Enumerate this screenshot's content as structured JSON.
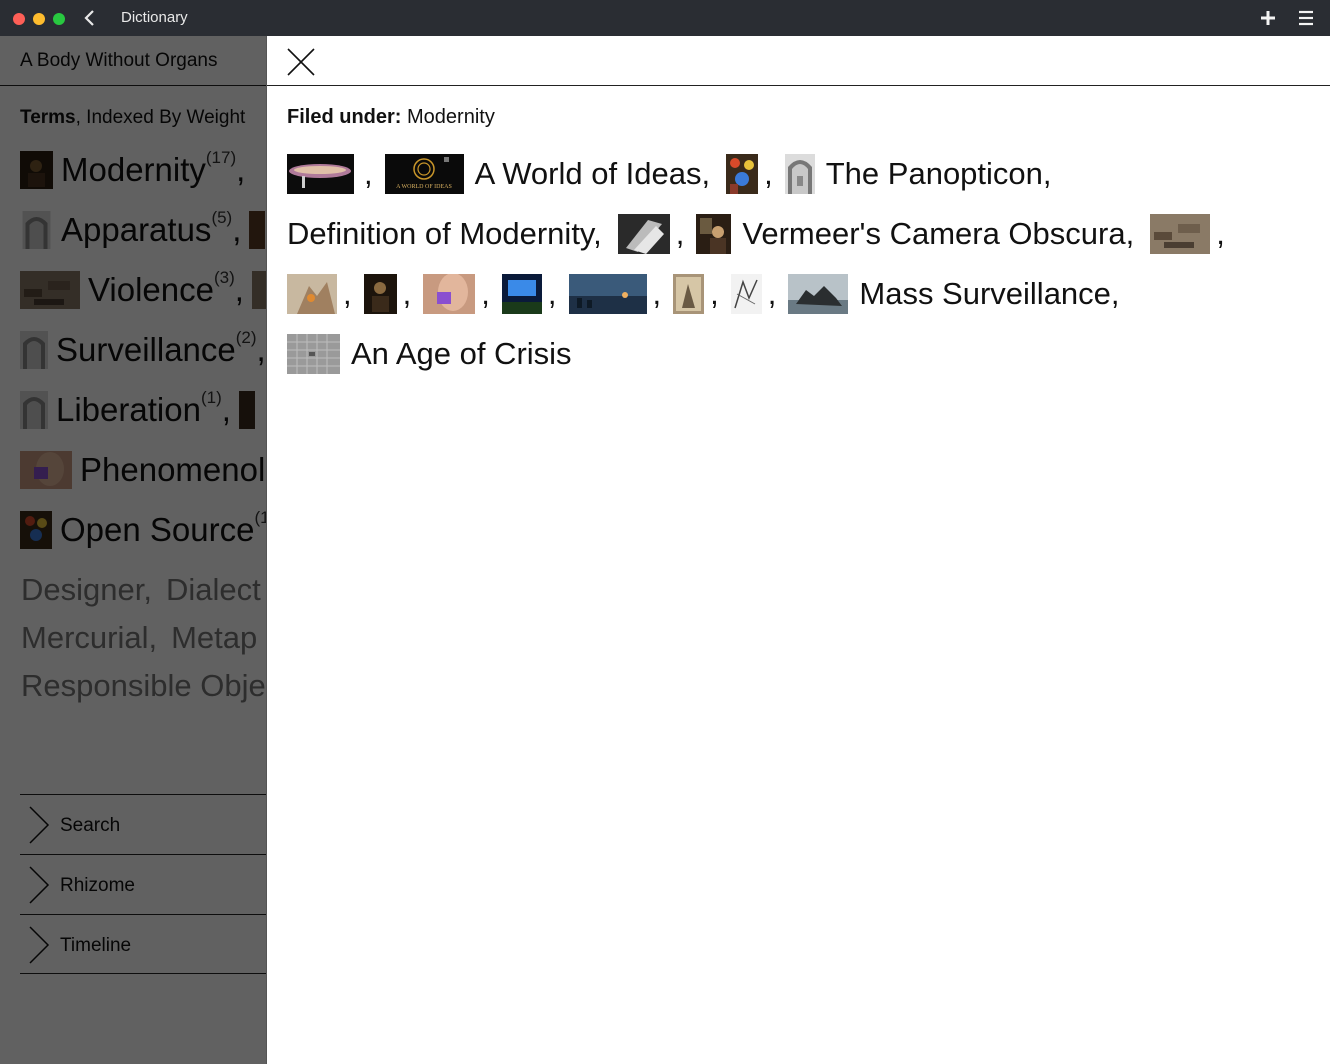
{
  "window": {
    "title": "Dictionary"
  },
  "sidebar": {
    "title": "A Body Without Organs",
    "caption_bold": "Terms",
    "caption_rest": ", Indexed By Weight",
    "terms": [
      {
        "name": "Modernity",
        "count": "(17)",
        "sep": ","
      },
      {
        "name": "Apparatus",
        "count": "(5)",
        "sep": ","
      },
      {
        "name": "Violence",
        "count": "(3)",
        "sep": ","
      },
      {
        "name": "Surveillance",
        "count": "(2)",
        "sep": ","
      },
      {
        "name": "Liberation",
        "count": "(1)",
        "sep": ","
      },
      {
        "name": "Phenomenol",
        "count": "",
        "sep": ""
      },
      {
        "name": "Open Source",
        "count": "(1",
        "sep": ""
      }
    ],
    "faint_terms": [
      [
        "Designer,",
        "Dialect"
      ],
      [
        "Mercurial,",
        "Metap"
      ],
      [
        "Responsible Obje"
      ]
    ],
    "sections": [
      "Search",
      "Rhizome",
      "Timeline"
    ]
  },
  "panel": {
    "filed_label": "Filed under:",
    "filed_value": "Modernity",
    "links": {
      "a_world_of_ideas": "A World of Ideas,",
      "the_panopticon": "The Panopticon,",
      "definition_of_modernity": "Definition of Modernity,",
      "vermeers_camera_obscura": "Vermeer's Camera Obscura,",
      "mass_surveillance": "Mass Surveillance,",
      "an_age_of_crisis": "An Age of Crisis"
    },
    "thumb_logo_text": "A WORLD OF IDEAS",
    "separator": ","
  },
  "colors": {
    "titlebar": "#2a2d33",
    "overlay": "rgba(0,0,0,0.62)",
    "text": "#111111"
  }
}
